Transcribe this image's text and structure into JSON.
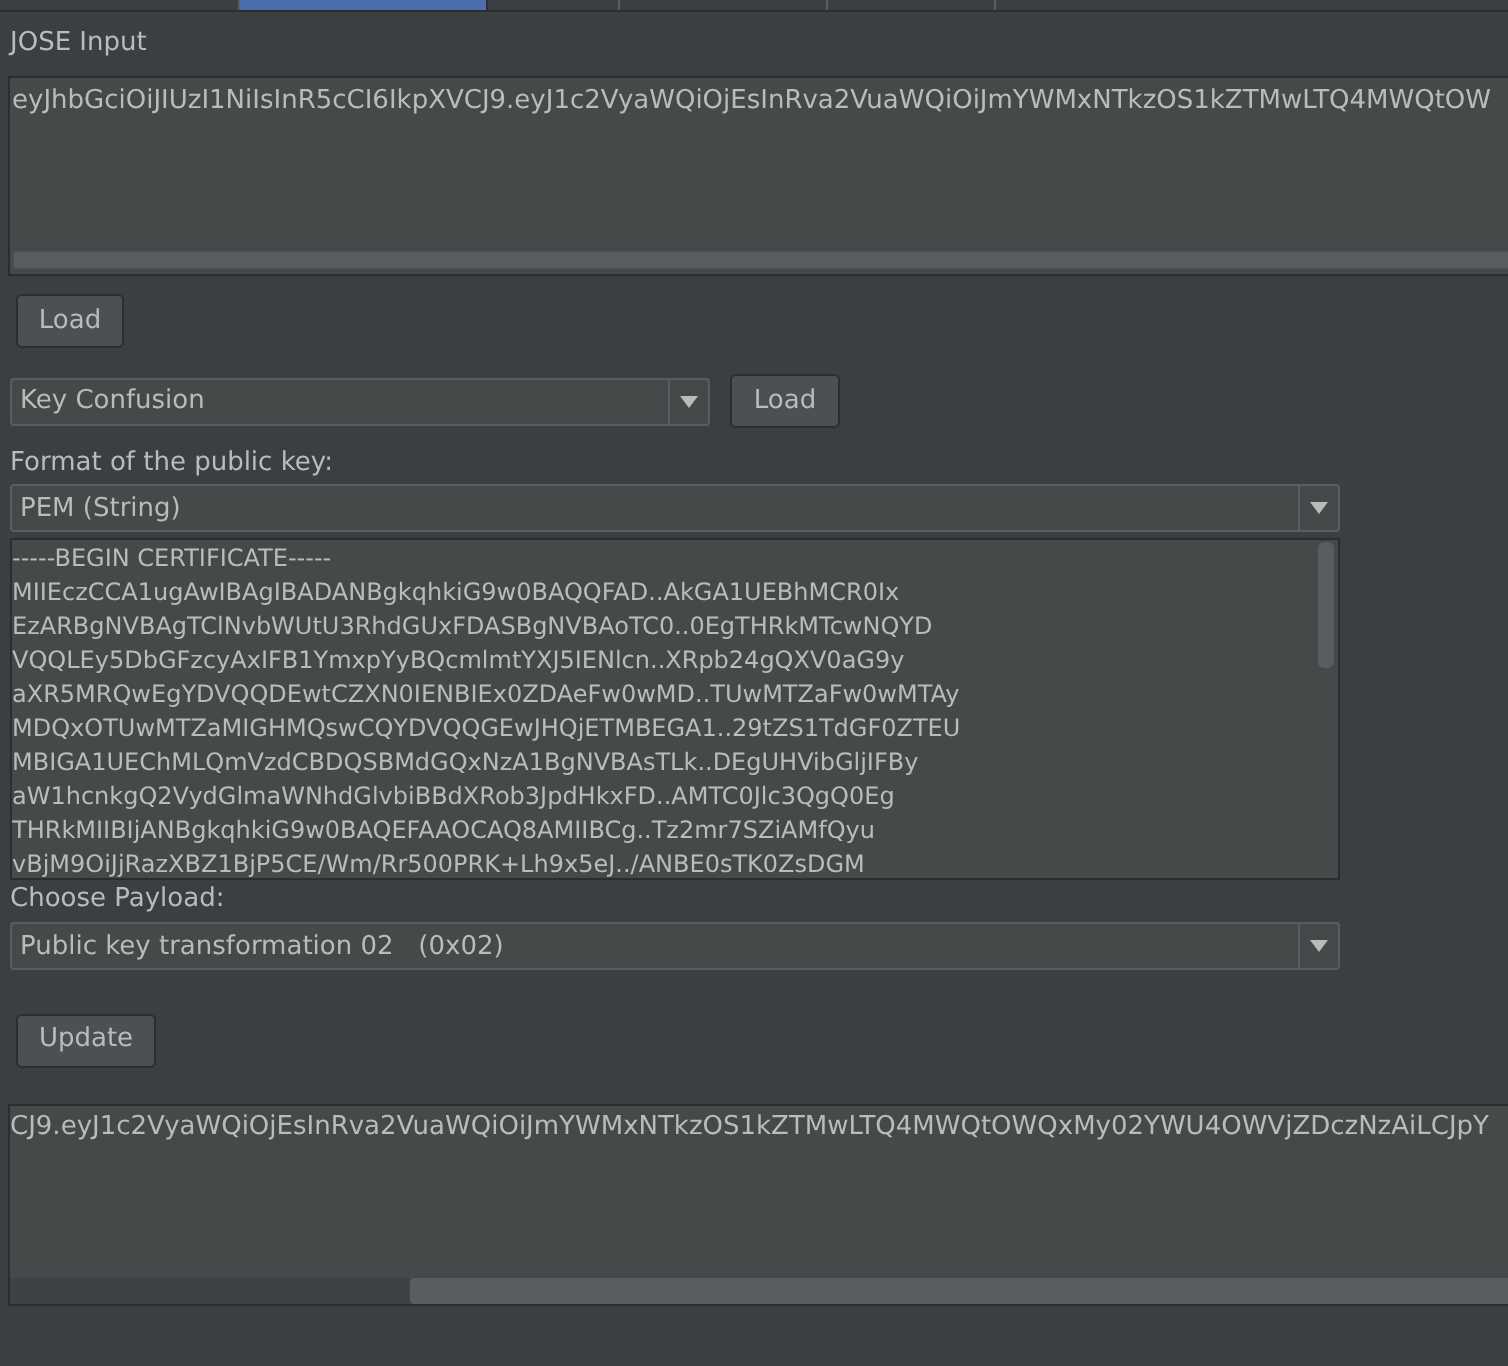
{
  "tabs": [
    {
      "selected": false
    },
    {
      "selected": true
    },
    {
      "selected": false
    },
    {
      "selected": false
    },
    {
      "selected": false
    }
  ],
  "jose_input": {
    "label": "JOSE Input",
    "value": "eyJhbGciOiJIUzI1NiIsInR5cCI6IkpXVCJ9.eyJ1c2VyaWQiOjEsInRva2VuaWQiOiJmYWMxNTkzOS1kZTMwLTQ4MWQtOW"
  },
  "load_button": "Load",
  "attack_select": {
    "value": "Key Confusion"
  },
  "attack_load_button": "Load",
  "key_format": {
    "label": "Format of the public key:",
    "value": "PEM (String)"
  },
  "public_key_lines": [
    "-----BEGIN CERTIFICATE-----",
    "MIIEczCCA1ugAwIBAgIBADANBgkqhkiG9w0BAQQFAD..AkGA1UEBhMCR0Ix",
    "EzARBgNVBAgTClNvbWUtU3RhdGUxFDASBgNVBAoTC0..0EgTHRkMTcwNQYD",
    "VQQLEy5DbGFzcyAxIFB1YmxpYyBQcmlmtYXJ5IENlcn..XRpb24gQXV0aG9y",
    "aXR5MRQwEgYDVQQDEwtCZXN0IENBIEx0ZDAeFw0wMD..TUwMTZaFw0wMTAy",
    "MDQxOTUwMTZaMIGHMQswCQYDVQQGEwJHQjETMBEGA1..29tZS1TdGF0ZTEU",
    "MBIGA1UEChMLQmVzdCBDQSBMdGQxNzA1BgNVBAsTLk..DEgUHVibGljIFBy",
    "aW1hcnkgQ2VydGlmaWNhdGlvbiBBdXRob3JpdHkxFD..AMTC0Jlc3QgQ0Eg",
    "THRkMIIBIjANBgkqhkiG9w0BAQEFAAOCAQ8AMIIBCg..Tz2mr7SZiAMfQyu",
    "vBjM9OiJjRazXBZ1BjP5CE/Wm/Rr500PRK+Lh9x5eJ../ANBE0sTK0ZsDGM"
  ],
  "payload": {
    "label": "Choose Payload:",
    "value": "Public key transformation 02   (0x02)"
  },
  "update_button": "Update",
  "output": {
    "value": "CJ9.eyJ1c2VyaWQiOjEsInRva2VuaWQiOiJmYWMxNTkzOS1kZTMwLTQ4MWQtOWQxMy02YWU4OWVjZDczNzAiLCJpY"
  }
}
